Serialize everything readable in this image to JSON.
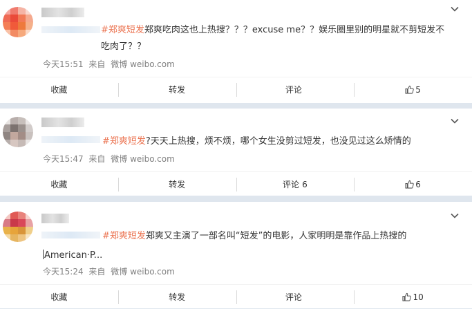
{
  "posts": [
    {
      "hashtag": "#郑爽短发",
      "text": "郑爽吃肉这也上热搜？？？excuse me？？娱乐圈里别的明星就不剪短发不吃肉了？？",
      "time": "今天15:51",
      "source_prefix": "来自",
      "source": "微博 weibo.com",
      "actions": {
        "collect": "收藏",
        "repost": "转发",
        "comment": "评论",
        "comment_count": "",
        "like_count": "5"
      }
    },
    {
      "hashtag": "#郑爽短发",
      "text": "?天天上热搜，烦不烦，哪个女生没剪过短发，也没见过这么矫情的",
      "time": "今天15:47",
      "source_prefix": "来自",
      "source": "微博 weibo.com",
      "actions": {
        "collect": "收藏",
        "repost": "转发",
        "comment": "评论",
        "comment_count": "6",
        "like_count": "6"
      }
    },
    {
      "hashtag": "#郑爽短发",
      "text": "郑爽又主演了一部名叫“短发”的电影，人家明明是靠作品上热搜的",
      "text2": "American·P...",
      "time": "今天15:24",
      "source_prefix": "来自",
      "source": "微博 weibo.com",
      "actions": {
        "collect": "收藏",
        "repost": "转发",
        "comment": "评论",
        "comment_count": "",
        "like_count": "10"
      }
    }
  ],
  "colors": {
    "hashtag": "#eb7350",
    "meta": "#808080",
    "background": "#dfe6ee"
  },
  "icons": {
    "menu": "chevron-down-icon",
    "like": "thumbs-up-icon"
  }
}
